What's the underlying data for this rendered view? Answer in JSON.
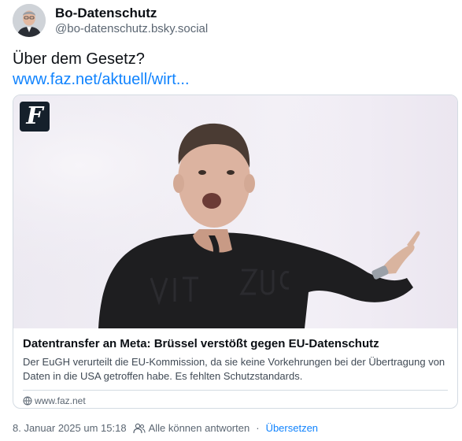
{
  "author": {
    "display_name": "Bo-Datenschutz",
    "handle": "@bo-datenschutz.bsky.social"
  },
  "post": {
    "text": "Über dem Gesetz?",
    "link_text": "www.faz.net/aktuell/wirt..."
  },
  "card": {
    "logo_glyph": "F",
    "title": "Datentransfer an Meta: Brüssel verstößt gegen EU-Datenschutz",
    "description": "Der EuGH verurteilt die EU-Kommission, da sie keine Vorkehrungen bei der Übertragung von Daten in die USA getroffen habe. Es fehlten Schutzstandards.",
    "source": "www.faz.net"
  },
  "meta": {
    "timestamp": "8. Januar 2025 um 15:18",
    "reply_setting": "Alle können antworten",
    "separator": "·",
    "translate_label": "Übersetzen"
  },
  "colors": {
    "accent": "#1083fe",
    "text": "#0b0f14",
    "muted": "#5b6672",
    "border": "#d4dbe2"
  },
  "icons": {
    "reply_setting": "people-icon",
    "source": "globe-icon"
  }
}
